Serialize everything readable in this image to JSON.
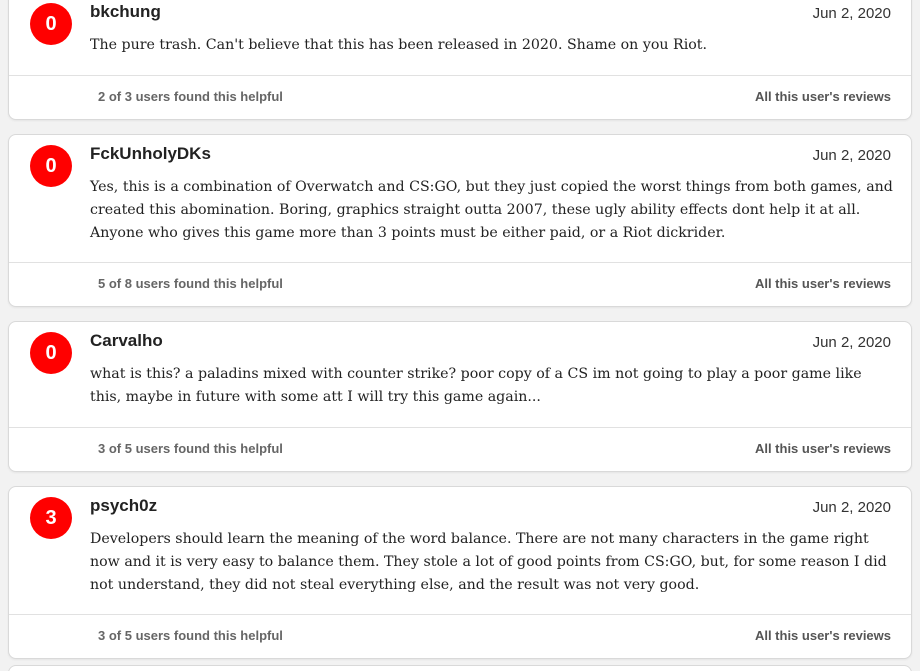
{
  "reviews": [
    {
      "score": "0",
      "author": "bkchung",
      "date": "Jun 2, 2020",
      "text": "The pure trash. Can't believe that this has been released in 2020. Shame on you Riot.",
      "helpful": "2 of 3 users found this helpful",
      "all_reviews_label": "All this user's reviews"
    },
    {
      "score": "0",
      "author": "FckUnholyDKs",
      "date": "Jun 2, 2020",
      "text": "Yes, this is a combination of Overwatch and CS:GO, but they just copied the worst things from both games, and created this abomination. Boring, graphics straight outta 2007, these ugly ability effects dont help it at all. Anyone who gives this game more than 3 points must be either paid, or a Riot dickrider.",
      "helpful": "5 of 8 users found this helpful",
      "all_reviews_label": "All this user's reviews"
    },
    {
      "score": "0",
      "author": "Carvalho",
      "date": "Jun 2, 2020",
      "text": "what is this? a paladins mixed with counter strike? poor copy of a CS im not going to play a poor game like this, maybe in future with some att I will try this game again...",
      "helpful": "3 of 5 users found this helpful",
      "all_reviews_label": "All this user's reviews"
    },
    {
      "score": "3",
      "author": "psych0z",
      "date": "Jun 2, 2020",
      "text": "Developers should learn the meaning of the word balance. There are not many characters in the game right now and it is very easy to balance them. They stole a lot of good points from CS:GO, but, for some reason I did not understand, they did not steal everything else, and the result was not very good.",
      "helpful": "3 of 5 users found this helpful",
      "all_reviews_label": "All this user's reviews"
    }
  ],
  "colors": {
    "score_badge": "#ff0000",
    "card_background": "#ffffff",
    "page_background": "#f2f2f2"
  }
}
